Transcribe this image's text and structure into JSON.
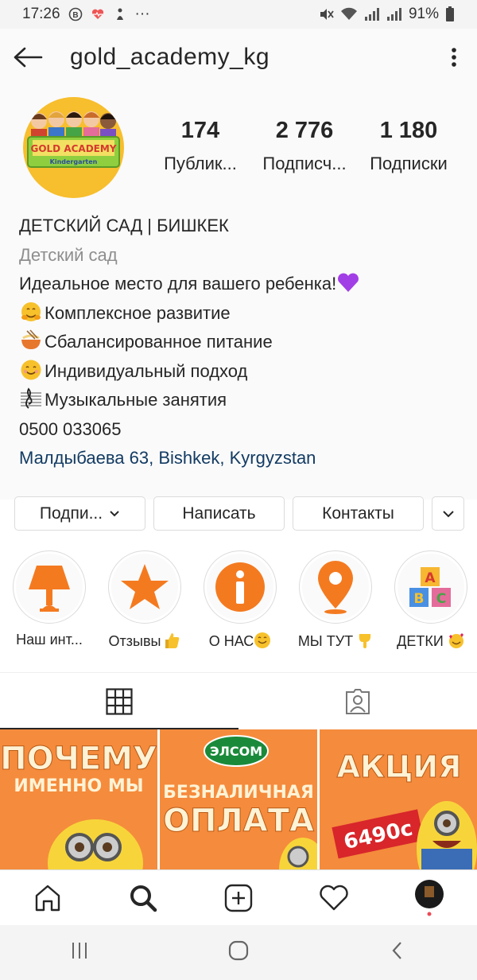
{
  "status_bar": {
    "time": "17:26",
    "dots": "···",
    "battery": "91%"
  },
  "header": {
    "username": "gold_academy_kg"
  },
  "avatar": {
    "logo_text": "GOLD ACADEMY",
    "logo_sub": "Kindergarten",
    "bg_color": "#f7be2d"
  },
  "stats": [
    {
      "value": "174",
      "label": "Публик..."
    },
    {
      "value": "2 776",
      "label": "Подписч..."
    },
    {
      "value": "1 180",
      "label": "Подписки"
    }
  ],
  "bio": {
    "name": "ДЕТСКИЙ САД | БИШКЕК",
    "category": "Детский сад",
    "line1": "Идеальное место для вашего ребенка!",
    "line2": "Комплексное развитие",
    "line3": "Сбалансированное питание",
    "line4": "Индивидуальный подход",
    "line5": "Музыкальные занятия",
    "phone": "0500 033065",
    "address": "Малдыбаева 63, Bishkek, Kyrgyzstan"
  },
  "buttons": {
    "follow": "Подпи...",
    "message": "Написать",
    "contacts": "Контакты"
  },
  "highlights": [
    {
      "label": "Наш инт..."
    },
    {
      "label": "Отзывы"
    },
    {
      "label": "О НАС"
    },
    {
      "label": "МЫ ТУТ"
    },
    {
      "label": "ДЕТКИ"
    }
  ],
  "posts": [
    {
      "line1": "ПОЧЕМУ",
      "line2": "ИМЕННО МЫ"
    },
    {
      "badge": "ЭЛСОМ",
      "line1": "БЕЗНАЛИЧНАЯ",
      "line2": "ОПЛАТА"
    },
    {
      "line1": "АКЦИЯ",
      "price": "6490с"
    }
  ],
  "colors": {
    "accent_orange": "#f47a20",
    "link": "#133b63",
    "post_bg": "#f48a3a"
  }
}
